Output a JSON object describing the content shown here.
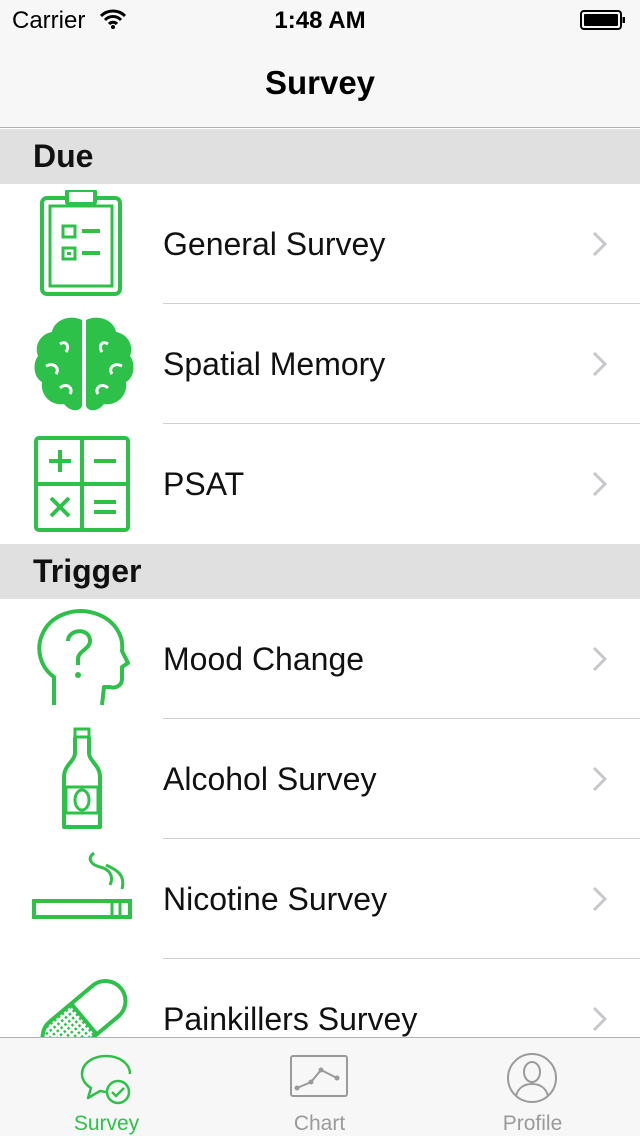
{
  "status_bar": {
    "carrier": "Carrier",
    "time": "1:48 AM"
  },
  "nav": {
    "title": "Survey"
  },
  "sections": [
    {
      "title": "Due",
      "items": [
        {
          "label": "General Survey",
          "icon": "clipboard-icon"
        },
        {
          "label": "Spatial Memory",
          "icon": "brain-icon"
        },
        {
          "label": "PSAT",
          "icon": "calculator-icon"
        }
      ]
    },
    {
      "title": "Trigger",
      "items": [
        {
          "label": "Mood Change",
          "icon": "head-question-icon"
        },
        {
          "label": "Alcohol Survey",
          "icon": "bottle-icon"
        },
        {
          "label": "Nicotine Survey",
          "icon": "cigarette-icon"
        },
        {
          "label": "Painkillers Survey",
          "icon": "pill-icon"
        }
      ]
    }
  ],
  "tabs": [
    {
      "label": "Survey",
      "icon": "survey-chat-icon",
      "active": true
    },
    {
      "label": "Chart",
      "icon": "chart-icon",
      "active": false
    },
    {
      "label": "Profile",
      "icon": "profile-icon",
      "active": false
    }
  ],
  "colors": {
    "accent": "#2ec14a",
    "inactive": "#9a9a9a",
    "section_bg": "#e0e0e0",
    "bar_bg": "#f7f7f7"
  }
}
